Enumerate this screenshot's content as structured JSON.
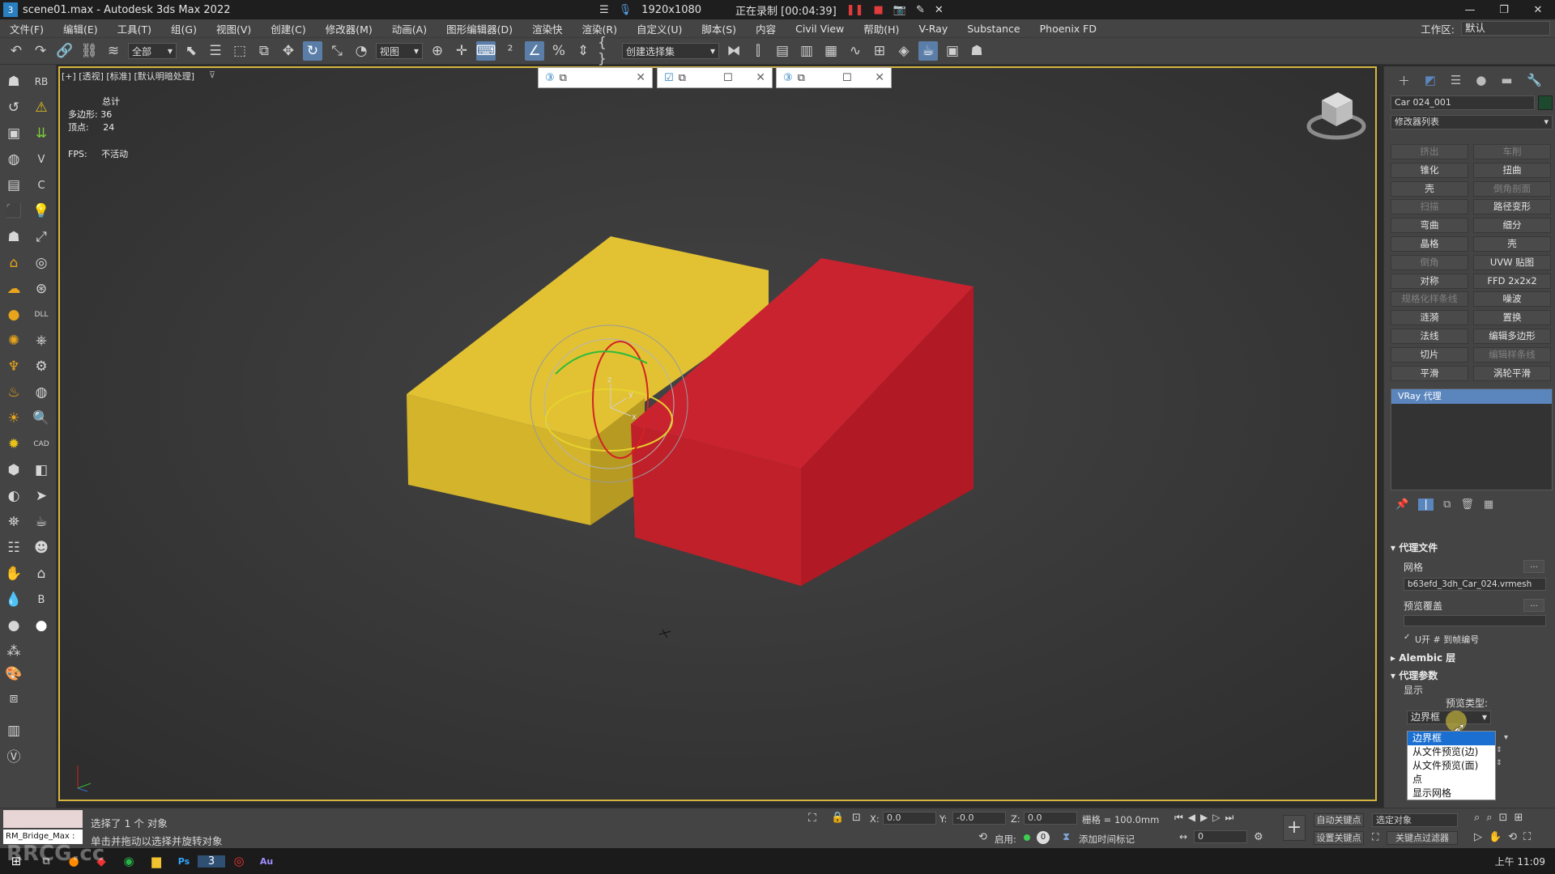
{
  "window": {
    "title": "scene01.max - Autodesk 3ds Max 2022",
    "logo": "3",
    "resolution": "1920x1080",
    "recording": "正在录制 [00:04:39]",
    "controls": [
      "—",
      "❐",
      "✕"
    ]
  },
  "menu": {
    "items": [
      "文件(F)",
      "编辑(E)",
      "工具(T)",
      "组(G)",
      "视图(V)",
      "创建(C)",
      "修改器(M)",
      "动画(A)",
      "图形编辑器(D)",
      "渲染快",
      "渲染(R)",
      "自定义(U)",
      "脚本(S)",
      "内容",
      "Civil View",
      "帮助(H)",
      "V-Ray",
      "Substance",
      "Phoenix FD"
    ],
    "workspace_label": "工作区:",
    "workspace_value": "默认"
  },
  "toolbar": {
    "filter_select": "全部",
    "ref_coord": "视图",
    "named_sel": "创建选择集"
  },
  "lefttools": {
    "labels": [
      "RB",
      "V",
      "C",
      "DLL",
      "CAD",
      "B"
    ]
  },
  "viewport": {
    "label": "[+] [透视] [标准] [默认明暗处理]",
    "stats_total": "总计",
    "stats_polys": "多边形:",
    "polys_value": "36",
    "stats_verts": "顶点:",
    "verts_value": "24",
    "fps_label": "FPS:",
    "fps_value": "不活动",
    "colors": {
      "yellow_top": "#e2c233",
      "yellow_front": "#d4b42b",
      "yellow_side": "#b79a22",
      "red_front": "#c0202a",
      "red_side": "#b11a24",
      "red_top": "#c92330"
    },
    "gizmo_axes": [
      "z",
      "y",
      "x"
    ]
  },
  "cmdpanel": {
    "object_name": "Car 024_001",
    "modifier_list": "修改器列表",
    "modifier_buttons": [
      [
        "挤出",
        "车削"
      ],
      [
        "锥化",
        "扭曲"
      ],
      [
        "壳",
        "倒角剖面"
      ],
      [
        "扫描",
        "路径变形"
      ],
      [
        "弯曲",
        "细分"
      ],
      [
        "晶格",
        "壳"
      ],
      [
        "倒角",
        "UVW 贴图"
      ],
      [
        "对称",
        "FFD 2x2x2"
      ],
      [
        "规格化样条线",
        "噪波"
      ],
      [
        "涟漪",
        "置换"
      ],
      [
        "法线",
        "编辑多边形"
      ],
      [
        "切片",
        "编辑样条线"
      ],
      [
        "平滑",
        "涡轮平滑"
      ]
    ],
    "dim_buttons": [
      "挤出",
      "车削",
      "倒角剖面",
      "扫描",
      "倒角",
      "规格化样条线",
      "编辑样条线"
    ],
    "stack_item": "VRay 代理",
    "rollout_proxy_file": "代理文件",
    "mesh_label": "网格",
    "mesh_file": "b63efd_3dh_Car_024.vrmesh",
    "preview_override": "预览覆盖",
    "frame_checkbox": "✓",
    "frame_label": "U开 # 到帧编号",
    "rollout_alembic": "Alembic 层",
    "rollout_proxy_params": "代理参数",
    "display_label": "显示",
    "preview_type": "预览类型:",
    "preview_value": "边界框",
    "dropdown_options": [
      "边界框",
      "从文件预览(边)",
      "从文件预览(面)",
      "点",
      "显示网格"
    ]
  },
  "statusbar": {
    "maxscript_label": "RM_Bridge_Max :",
    "selected": "选择了 1 个 对象",
    "hint": "单击并拖动以选择并旋转对象",
    "x_label": "X:",
    "x_value": "0.0",
    "y_label": "Y:",
    "y_value": "-0.0",
    "z_label": "Z:",
    "z_value": "0.0",
    "grid": "栅格 = 100.0mm",
    "enable": "启用:",
    "add_time_tag": "添加时间标记",
    "auto_key": "自动关键点",
    "selected_obj": "选定对象",
    "set_key": "设置关键点",
    "key_filter": "关键点过滤器",
    "frame_value": "0",
    "frame_num": "0"
  },
  "taskbar": {
    "clock": "上午 11:09",
    "watermark": "RRCG.cc"
  }
}
